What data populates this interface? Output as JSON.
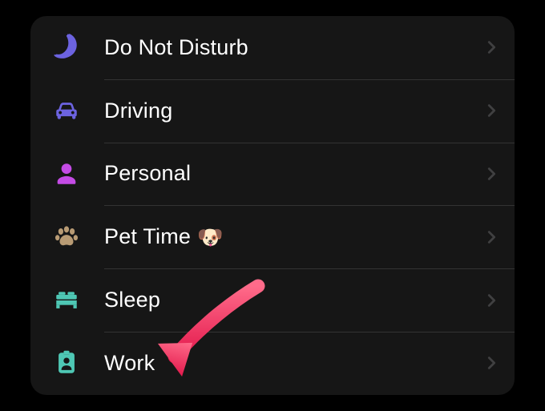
{
  "focus_modes": [
    {
      "id": "dnd",
      "label": "Do Not Disturb",
      "icon": "moon-icon",
      "color": "#6C63E0",
      "emoji": ""
    },
    {
      "id": "driving",
      "label": "Driving",
      "icon": "car-icon",
      "color": "#6C63E0",
      "emoji": ""
    },
    {
      "id": "personal",
      "label": "Personal",
      "icon": "person-icon",
      "color": "#C44BE5",
      "emoji": ""
    },
    {
      "id": "pettime",
      "label": "Pet Time",
      "icon": "paw-icon",
      "color": "#B89B74",
      "emoji": "🐶"
    },
    {
      "id": "sleep",
      "label": "Sleep",
      "icon": "bed-icon",
      "color": "#4EC7B4",
      "emoji": ""
    },
    {
      "id": "work",
      "label": "Work",
      "icon": "badge-icon",
      "color": "#4EC7B4",
      "emoji": ""
    }
  ],
  "annotation": {
    "arrow_color": "#F0285A",
    "arrow_highlight": "#FF6B8A"
  }
}
